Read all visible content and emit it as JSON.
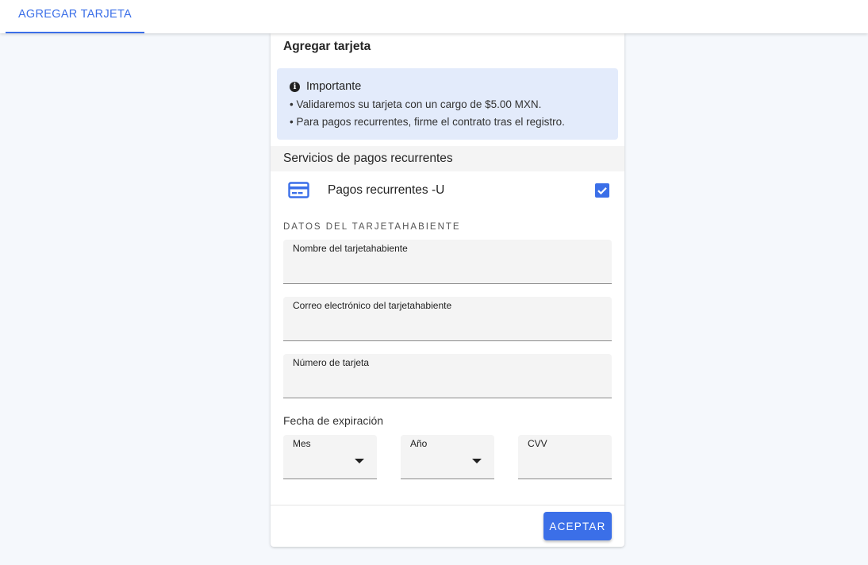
{
  "header": {
    "tab_label": "AGREGAR TARJETA"
  },
  "card": {
    "title": "Agregar tarjeta",
    "info": {
      "title": "Importante",
      "icon": "info-icon",
      "lines": [
        "• Validaremos su tarjeta con un cargo de $5.00 MXN.",
        "• Para pagos recurrentes, firme el contrato tras el registro."
      ]
    },
    "services": {
      "header": "Servicios de pagos recurrentes",
      "item": {
        "icon": "credit-card-icon",
        "label": "Pagos recurrentes -U",
        "checked": true
      }
    },
    "holder": {
      "section_label": "DATOS DEL TARJETAHABIENTE",
      "name_label": "Nombre del tarjetahabiente",
      "name_value": "",
      "email_label": "Correo electrónico del tarjetahabiente",
      "email_value": "",
      "number_label": "Número de tarjeta",
      "number_value": ""
    },
    "expiration": {
      "label": "Fecha de expiración",
      "month_label": "Mes",
      "year_label": "Año",
      "cvv_label": "CVV"
    },
    "accept_label": "ACEPTAR"
  },
  "colors": {
    "accent": "#3b6fe8",
    "info_bg": "#e3ebfb",
    "page_bg": "#f5f8fc",
    "field_bg": "#f4f4f4"
  }
}
